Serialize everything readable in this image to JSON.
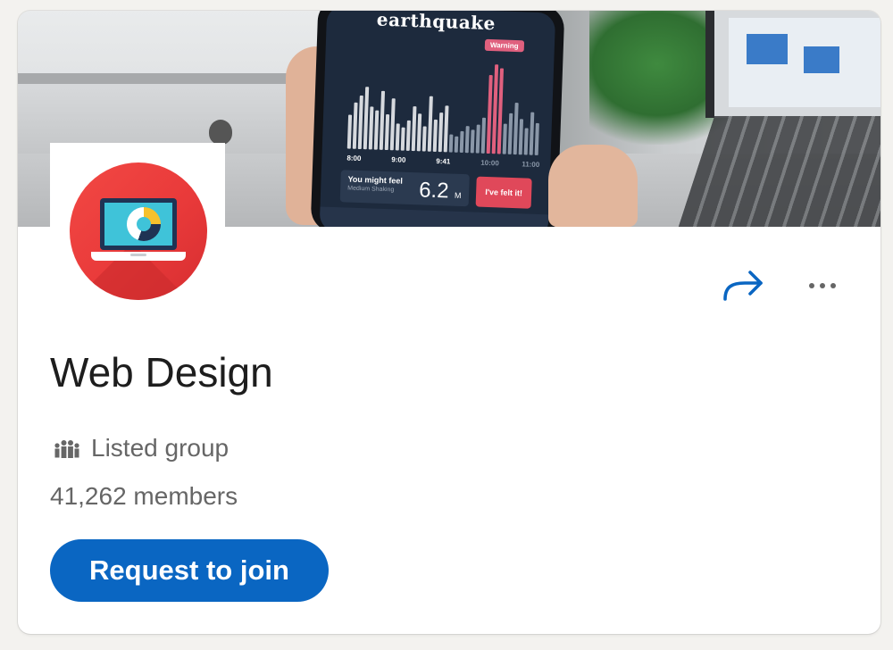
{
  "cover": {
    "app_title": "earthquake",
    "warning_badge": "Warning",
    "time_ticks": [
      "8:00",
      "9:00",
      "9:41",
      "10:00",
      "11:00"
    ],
    "felt_label": "You might feel",
    "felt_sub": "Medium Shaking",
    "magnitude": "6.2",
    "magnitude_unit": "M",
    "felt_button": "I've felt it!"
  },
  "logo": {
    "icon": "laptop-pie-chart-icon",
    "circle_color": "#f24844"
  },
  "actions": {
    "share_icon": "share-arrow-icon",
    "more_icon": "more-horizontal-icon"
  },
  "group": {
    "name": "Web Design",
    "visibility_icon": "group-people-icon",
    "visibility": "Listed group",
    "members": "41,262 members"
  },
  "join_button": {
    "label": "Request to join"
  },
  "colors": {
    "primary": "#0a66c2",
    "text": "#1d1d1d",
    "secondary_text": "#666666",
    "page_background": "#f3f2ef"
  }
}
